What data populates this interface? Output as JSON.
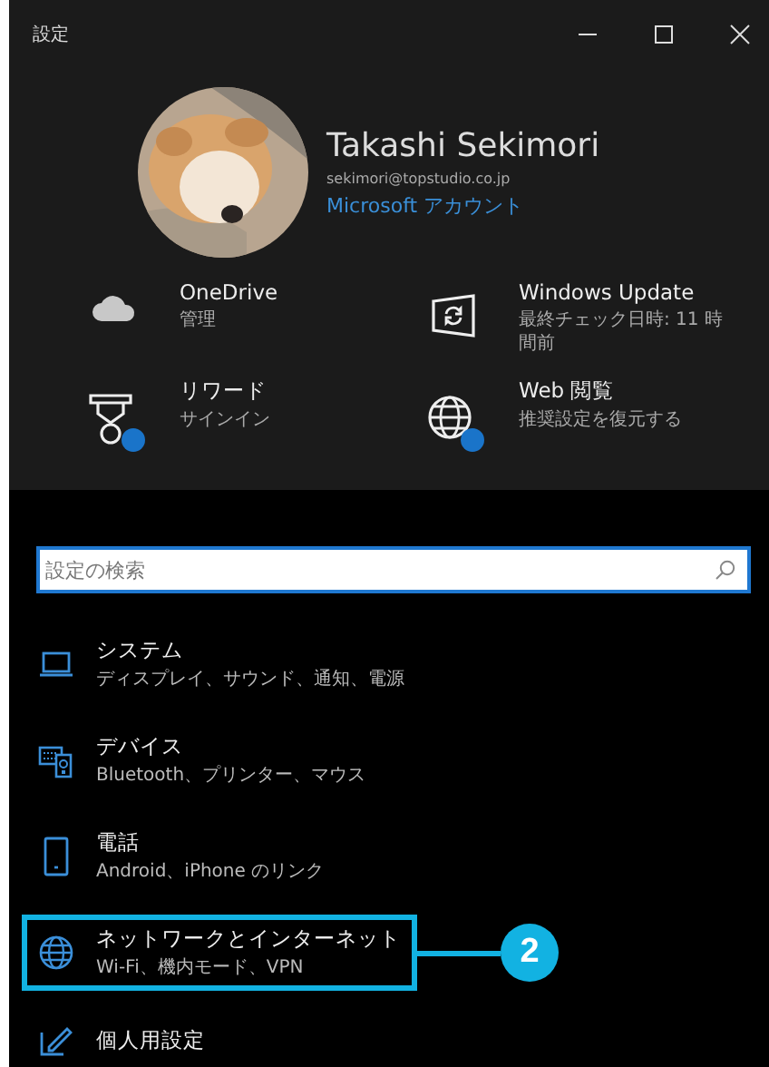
{
  "window": {
    "title": "設定"
  },
  "profile": {
    "name": "Takashi Sekimori",
    "email": "sekimori@topstudio.co.jp",
    "account_link": "Microsoft アカウント"
  },
  "quick_links": [
    {
      "kind": "cloud",
      "title": "OneDrive",
      "subtitle": "管理",
      "badge": false
    },
    {
      "kind": "update",
      "title": "Windows Update",
      "subtitle": "最終チェック日時: 11 時間前",
      "badge": false
    },
    {
      "kind": "reward",
      "title": "リワード",
      "subtitle": "サインイン",
      "badge": true
    },
    {
      "kind": "globe",
      "title": "Web 閲覧",
      "subtitle": "推奨設定を復元する",
      "badge": true
    }
  ],
  "search": {
    "placeholder": "設定の検索"
  },
  "categories": [
    {
      "kind": "laptop",
      "title": "システム",
      "subtitle": "ディスプレイ、サウンド、通知、電源",
      "highlighted": false
    },
    {
      "kind": "devices",
      "title": "デバイス",
      "subtitle": "Bluetooth、プリンター、マウス",
      "highlighted": false
    },
    {
      "kind": "phone",
      "title": "電話",
      "subtitle": "Android、iPhone のリンク",
      "highlighted": false
    },
    {
      "kind": "globe",
      "title": "ネットワークとインターネット",
      "subtitle": "Wi-Fi、機内モード、VPN",
      "highlighted": true
    },
    {
      "kind": "pen",
      "title": "個人用設定",
      "highlighted": false
    }
  ],
  "callout": {
    "number": "2"
  }
}
